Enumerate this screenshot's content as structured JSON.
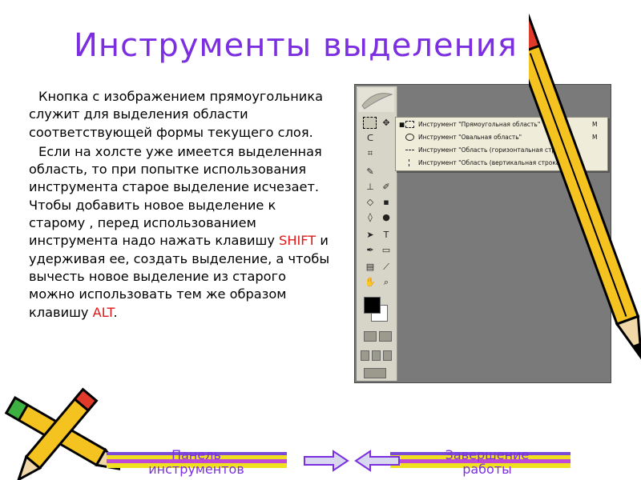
{
  "slide": {
    "title": "Инструменты выделения",
    "paragraph1": "Кнопка с изображением прямоугольника служит для выделения области соответствующей формы текущего слоя.",
    "paragraph2_part1": "Если на холсте уже имеется выделенная область, то при попытке использования инструмента старое выделение исчезает. Чтобы добавить новое выделение к старому , перед использованием инструмента надо нажать клавишу ",
    "paragraph2_key1": "SHIFT",
    "paragraph2_part2": " и удерживая ее, создать выделение, а чтобы вычесть новое выделение из старого можно использовать тем же образом клавишу ",
    "paragraph2_key2": "ALT",
    "paragraph2_part3": ".",
    "accent_color": "#7b2fe0",
    "key_color": "#e0181a"
  },
  "screenshot": {
    "flyout_items": [
      {
        "bullet": "■",
        "icon": "rect-marquee-icon",
        "label": "Инструмент \"Прямоугольная область\"",
        "key": "M"
      },
      {
        "bullet": "",
        "icon": "ellipse-marquee-icon",
        "label": "Инструмент \"Овальная область\"",
        "key": "M"
      },
      {
        "bullet": "",
        "icon": "single-row-marquee-icon",
        "label": "Инструмент \"Область (горизонтальная строка)\"",
        "key": ""
      },
      {
        "bullet": "",
        "icon": "single-column-marquee-icon",
        "label": "Инструмент \"Область (вертикальная строка)\"",
        "key": ""
      }
    ],
    "type_tool_glyph": "T"
  },
  "nav": {
    "left_label": "Панель инструментов",
    "right_label": "Завершение работы"
  }
}
